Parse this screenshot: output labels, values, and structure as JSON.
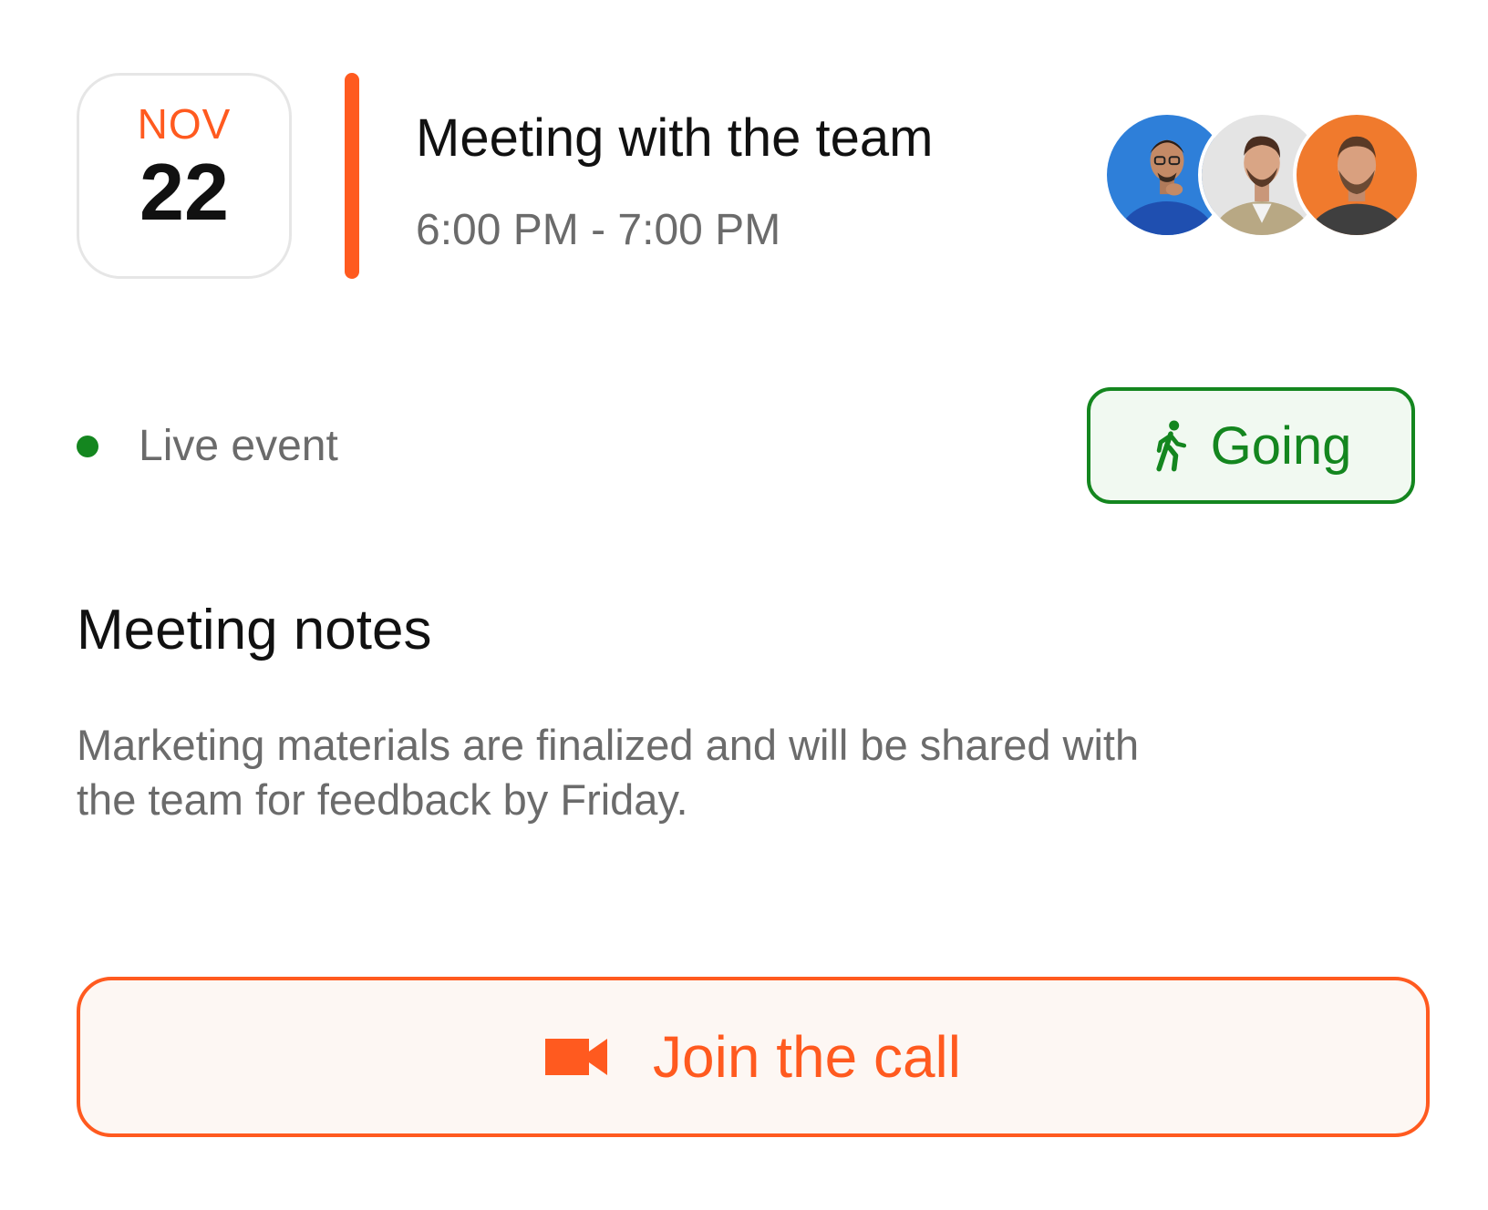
{
  "event": {
    "month": "NOV",
    "day": "22",
    "title": "Meeting with the team",
    "time": "6:00 PM - 7:00 PM"
  },
  "attendees": [
    {
      "avatar": "person-blue-sweater-avatar",
      "bg": "#2e7fd9"
    },
    {
      "avatar": "person-beige-shirt-avatar",
      "bg": "#e4e4e4"
    },
    {
      "avatar": "person-orange-bg-avatar",
      "bg": "#f07a2d"
    }
  ],
  "status": {
    "label": "Live event",
    "color": "#14861f"
  },
  "rsvp": {
    "label": "Going",
    "icon": "walking-person-icon",
    "color": "#14861f"
  },
  "notes": {
    "title": "Meeting notes",
    "body": "Marketing materials are finalized and will be shared with the team for feedback by Friday."
  },
  "join": {
    "label": "Join the call",
    "icon": "video-camera-icon",
    "color": "#ff5a1f"
  }
}
